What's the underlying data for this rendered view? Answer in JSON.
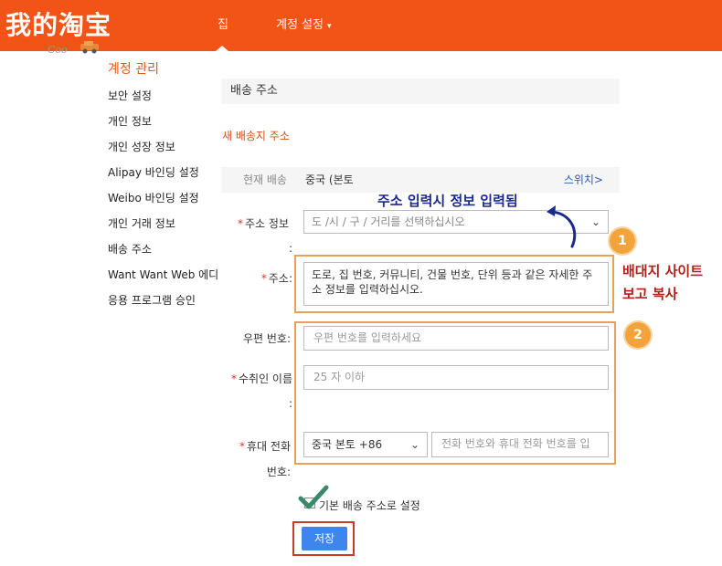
{
  "header": {
    "logo": "我的淘宝",
    "logo_sub": "Coo",
    "nav_home": "집",
    "nav_settings": "계정 설정",
    "nav_settings_arrow": "▾"
  },
  "sidebar": {
    "title": "계정 관리",
    "items": [
      {
        "label": "보안 설정"
      },
      {
        "label": "개인 정보"
      },
      {
        "label": "개인 성장 정보"
      },
      {
        "label": "Alipay 바인딩 설정"
      },
      {
        "label": "Weibo 바인딩 설정"
      },
      {
        "label": "개인 거래 정보"
      },
      {
        "label": "배송 주소"
      },
      {
        "label": "Want Want Web 에디"
      },
      {
        "label": "응용 프로그램 승인"
      }
    ]
  },
  "main": {
    "page_title": "배송 주소",
    "new_address": "새 배송지 주소",
    "current_label": "현재 배송",
    "current_value": "중국 (본토",
    "switch_label": "스위치>",
    "form": {
      "address_info_label": "주소 정보",
      "address_info_colon": ":",
      "region_placeholder": "도 /시 / 구 / 거리를 선택하십시오",
      "address_label": "주소:",
      "address_placeholder": "도로, 집 번호, 커뮤니티, 건물 번호, 단위 등과 같은 자세한 주소 정보를 입력하십시오.",
      "zip_label": "우편 번호:",
      "zip_placeholder": "우편 번호를 입력하세요",
      "recipient_label": "수취인 이름",
      "recipient_colon": ":",
      "recipient_placeholder": "25 자 이하",
      "phone_label": "휴대 전화",
      "phone_label_2": "번호:",
      "country_code": "중국 본토 +86",
      "phone_placeholder": "전화 번호와 휴대 전화 번호를 입",
      "default_checkbox_label": "기본 배송 주소로 설정",
      "default_checked": true,
      "save_label": "저장",
      "required_mark": "*"
    }
  },
  "annotations": {
    "blue_note": "주소 입력시 정보 입력됨",
    "badge_1": "1",
    "badge_2": "2",
    "red_note_line1": "배대지 사이트",
    "red_note_line2": "보고 복사",
    "colors": {
      "highlight_orange": "#e8a15a",
      "highlight_red": "#c83a2a",
      "badge": "#f2a33c",
      "brand_orange": "#f25418",
      "primary_blue": "#3e86ee"
    }
  }
}
